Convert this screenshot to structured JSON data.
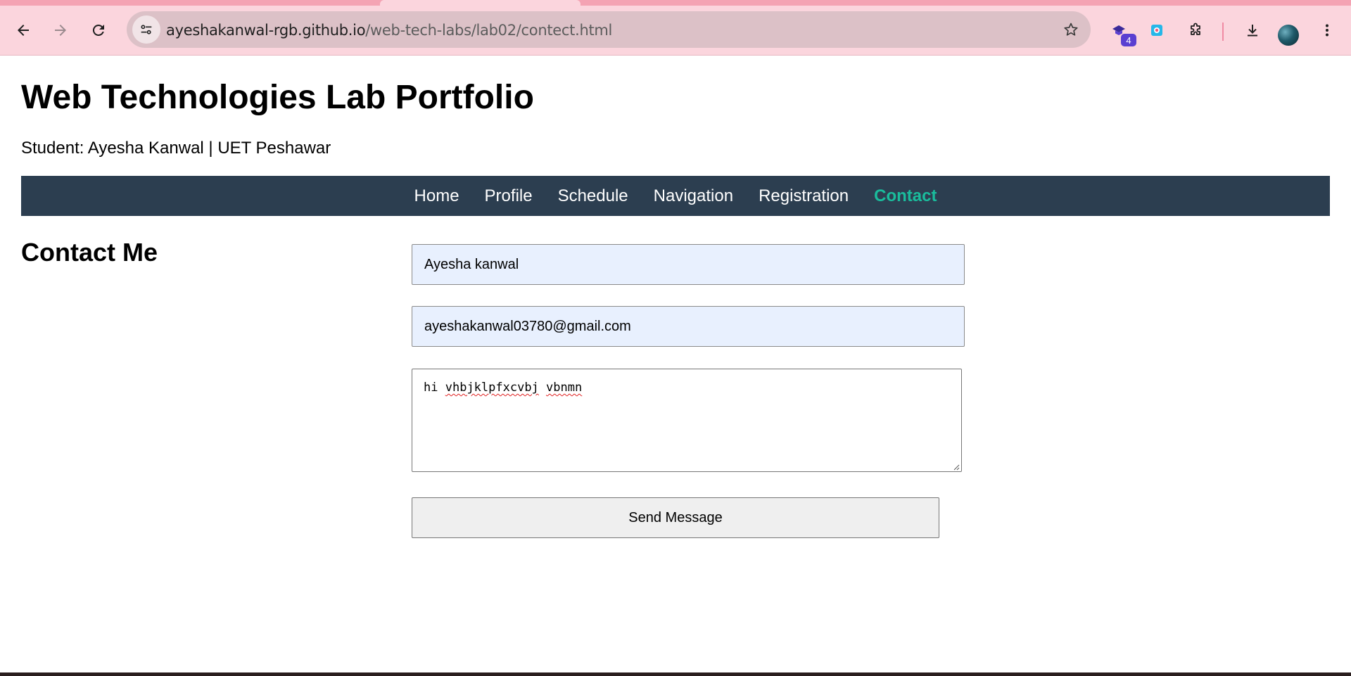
{
  "browser": {
    "url_host": "ayeshakanwal-rgb.github.io",
    "url_path": "/web-tech-labs/lab02/contect.html",
    "extension_badge": "4",
    "accent": "#fbd5dd"
  },
  "header": {
    "title": "Web Technologies Lab Portfolio",
    "subtitle": "Student: Ayesha Kanwal | UET Peshawar"
  },
  "nav": {
    "items": [
      {
        "label": "Home"
      },
      {
        "label": "Profile"
      },
      {
        "label": "Schedule"
      },
      {
        "label": "Navigation"
      },
      {
        "label": "Registration"
      },
      {
        "label": "Contact",
        "active": true
      }
    ],
    "background": "#2c3e50",
    "active_color": "#1abc9c"
  },
  "main": {
    "heading": "Contact Me",
    "form": {
      "name_value": "Ayesha kanwal",
      "email_value": "ayeshakanwal03780@gmail.com",
      "message_word_1": "hi",
      "message_word_2": "vhbjklpfxcvbj",
      "message_word_3": "vbnmn",
      "submit_label": "Send Message"
    }
  },
  "icons": [
    "back-arrow-icon",
    "forward-arrow-icon",
    "reload-icon",
    "site-info-icon",
    "star-icon",
    "extension-badge-icon",
    "color-picker-icon",
    "puzzle-icon",
    "download-icon",
    "more-vert-icon"
  ]
}
